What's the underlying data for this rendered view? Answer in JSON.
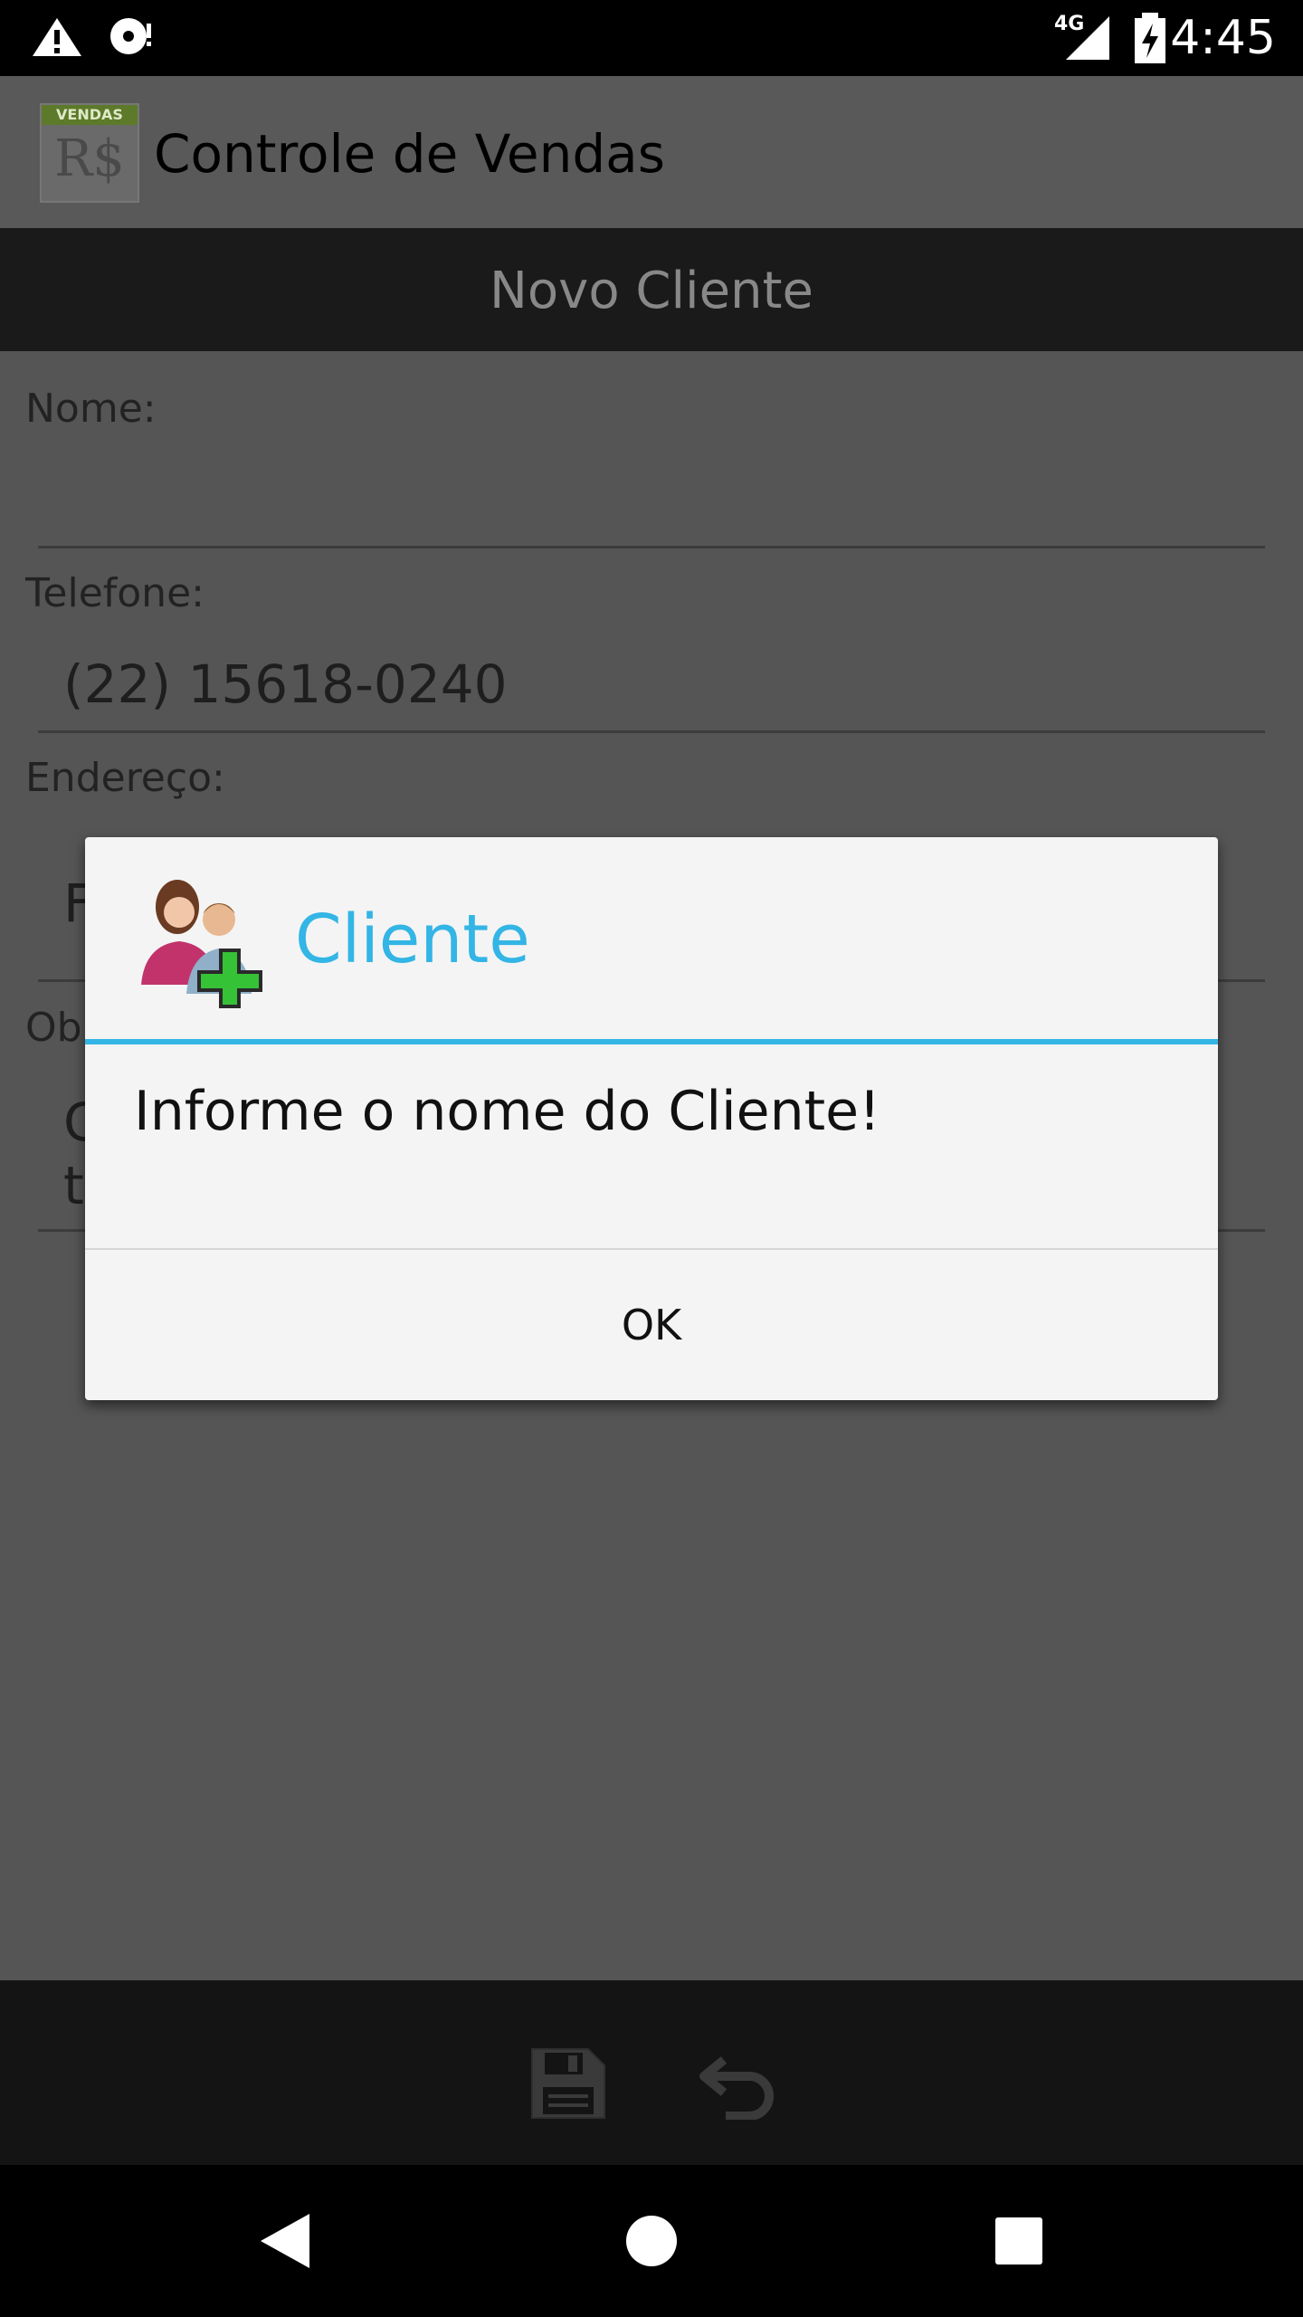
{
  "status_bar": {
    "time": "4:45",
    "network": "4G",
    "icons": [
      "warning-icon",
      "sync-disk-icon",
      "signal-icon",
      "battery-charging-icon"
    ]
  },
  "app_bar": {
    "logo_text": "VENDAS",
    "logo_symbol": "R$",
    "title": "Controle de Vendas"
  },
  "screen": {
    "title": "Novo Cliente"
  },
  "form": {
    "nome_label": "Nome:",
    "nome_value": "",
    "telefone_label": "Telefone:",
    "telefone_value": "(22) 15618-0240",
    "endereco_label": "Endereço:",
    "endereco_visible": "F",
    "obs_label_visible": "Ob",
    "obs_visible_line1": "C",
    "obs_visible_line2": "t"
  },
  "dialog": {
    "title": "Cliente",
    "message": "Informe o nome do Cliente!",
    "ok_label": "OK",
    "icon": "add-user-icon"
  },
  "toolbar": {
    "icons": [
      "save-icon",
      "undo-icon"
    ]
  },
  "nav": {
    "icons": [
      "back-icon",
      "home-icon",
      "recents-icon"
    ]
  },
  "colors": {
    "accent": "#33b5e5",
    "dialog_bg": "#f4f4f4",
    "dim_bg": "#555555"
  }
}
